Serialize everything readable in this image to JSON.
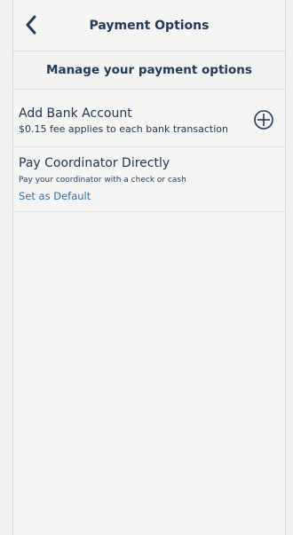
{
  "header": {
    "title": "Payment Options",
    "back_icon": "chevron-left-icon"
  },
  "subheader": {
    "text": "Manage your payment options"
  },
  "options": {
    "bank": {
      "title": "Add Bank Account",
      "subtitle": "$0.15 fee applies to each bank transaction",
      "action_icon": "plus-circle-icon"
    },
    "coordinator": {
      "title": "Pay Coordinator Directly",
      "subtitle": "Pay your coordinator with a check or cash",
      "action_label": "Set as Default"
    }
  },
  "colors": {
    "text": "#1f3552",
    "link": "#2a6fb3",
    "background": "#f5f5f4"
  }
}
